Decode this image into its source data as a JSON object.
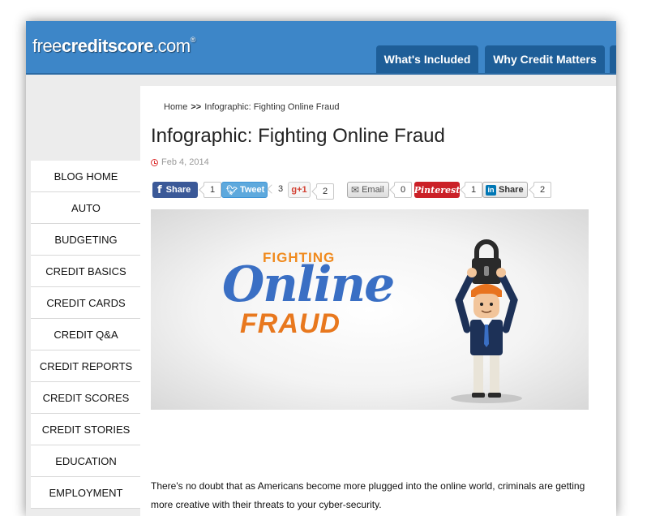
{
  "header": {
    "logo_regular": "free",
    "logo_bold": "creditscore",
    "logo_suffix": ".com",
    "logo_tm": "®",
    "nav": [
      {
        "label": "What's Included"
      },
      {
        "label": "Why Credit Matters"
      }
    ]
  },
  "sidebar": {
    "items": [
      {
        "label": "BLOG HOME"
      },
      {
        "label": "AUTO"
      },
      {
        "label": "BUDGETING"
      },
      {
        "label": "CREDIT BASICS"
      },
      {
        "label": "CREDIT CARDS"
      },
      {
        "label": "CREDIT Q&A"
      },
      {
        "label": "CREDIT REPORTS"
      },
      {
        "label": "CREDIT SCORES"
      },
      {
        "label": "CREDIT STORIES"
      },
      {
        "label": "EDUCATION"
      },
      {
        "label": "EMPLOYMENT"
      }
    ]
  },
  "breadcrumb": {
    "home": "Home",
    "separator": ">>",
    "current": "Infographic: Fighting Online Fraud"
  },
  "article": {
    "title": "Infographic: Fighting Online Fraud",
    "date": "Feb 4, 2014",
    "body": "There's no doubt that as Americans become more plugged into the online world, criminals are getting more creative with their threats to your cyber-security."
  },
  "share": {
    "facebook": {
      "label": "Share",
      "count": "1",
      "icon": "facebook-icon",
      "color": "#3b5998"
    },
    "twitter": {
      "label": "Tweet",
      "count": "3",
      "icon": "twitter-icon",
      "color": "#3d94d6"
    },
    "gplus": {
      "label": "g+1",
      "count": "2",
      "icon": "google-plus-icon",
      "color": "#d23f31"
    },
    "email": {
      "label": "Email",
      "count": "0",
      "icon": "envelope-icon"
    },
    "pinterest": {
      "label": "Pinterest",
      "count": "1",
      "icon": "pinterest-icon",
      "color": "#cb2027"
    },
    "linkedin": {
      "label": "Share",
      "count": "2",
      "icon": "linkedin-icon",
      "color": "#0077b5"
    }
  },
  "hero": {
    "line1": "FIGHTING",
    "line2": "Online",
    "line3": "FRAUD"
  },
  "colors": {
    "header_blue": "#3d86c8",
    "nav_tab": "#1e5e98",
    "hero_orange": "#f08a1d",
    "hero_blue": "#3a6fc4"
  }
}
